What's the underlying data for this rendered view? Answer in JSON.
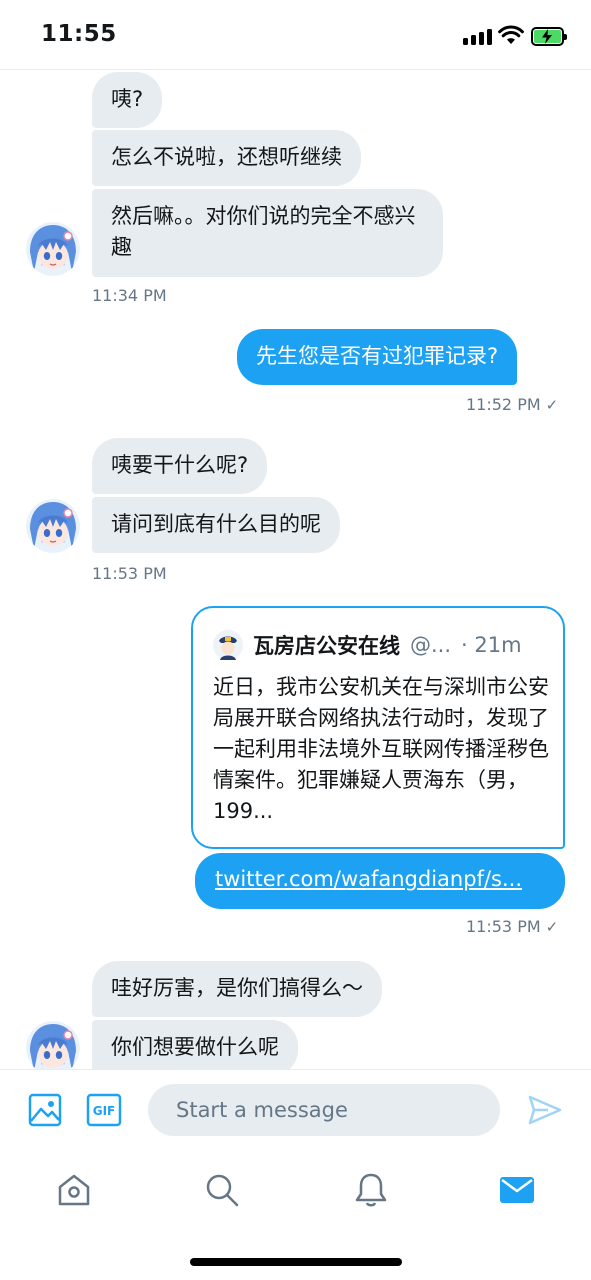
{
  "status_bar": {
    "time": "11:55"
  },
  "colors": {
    "accent": "#1da1f2",
    "incoming_bubble": "#e6ecf0",
    "secondary_text": "#657786",
    "battery": "#4cd964"
  },
  "messages": [
    {
      "direction": "incoming",
      "text": "咦?"
    },
    {
      "direction": "incoming",
      "text": "怎么不说啦，还想听继续"
    },
    {
      "direction": "incoming",
      "text": "然后嘛。。对你们说的完全不感兴趣"
    },
    {
      "direction": "outgoing",
      "text": "先生您是否有过犯罪记录?"
    },
    {
      "direction": "incoming",
      "text": "咦要干什么呢?"
    },
    {
      "direction": "incoming",
      "text": "请问到底有什么目的呢"
    },
    {
      "direction": "incoming",
      "text": "哇好厉害，是你们搞得么～"
    },
    {
      "direction": "incoming",
      "text": "你们想要做什么呢"
    }
  ],
  "timestamps": {
    "t1": "11:34 PM",
    "t2": "11:52 PM",
    "t3": "11:53 PM",
    "t4": "11:53 PM"
  },
  "quoted_tweet": {
    "author": "瓦房店公安在线",
    "handle": "@...",
    "time": "· 21m",
    "text": "近日，我市公安机关在与深圳市公安局展开联合网络执法行动时，发现了一起利用非法境外互联网传播淫秽色情案件。犯罪嫌疑人贾海东（男，199...",
    "link": "twitter.com/wafangdianpf/s..."
  },
  "composer": {
    "placeholder": "Start a message",
    "icons": [
      "image-icon",
      "gif-icon",
      "send-icon"
    ]
  },
  "tabbar": {
    "icons": [
      "home-icon",
      "search-icon",
      "bell-icon",
      "mail-icon"
    ],
    "active": "mail-icon"
  }
}
